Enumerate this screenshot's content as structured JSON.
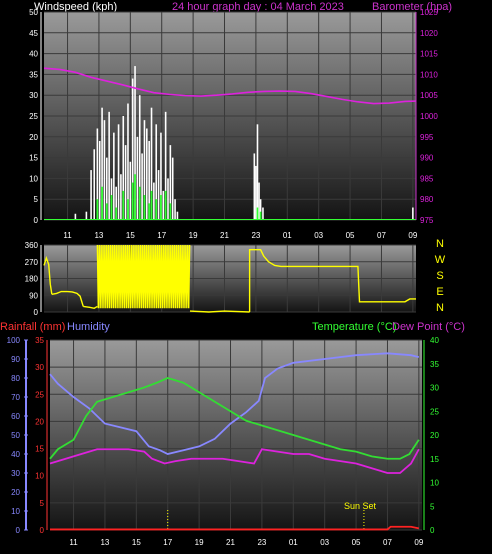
{
  "header": {
    "left": "Windspeed (kph)",
    "center": "24 hour graph day : 04 March 2023",
    "right": "Barometer (hpa)"
  },
  "time_ticks": [
    "11",
    "13",
    "15",
    "17",
    "19",
    "21",
    "23",
    "01",
    "03",
    "05",
    "07",
    "09"
  ],
  "colors": {
    "background": "#000000",
    "wind": "#ffffff",
    "gust": "#ffffff",
    "windavg": "#33ff33",
    "barometer": "#dd22dd",
    "direction": "#ffff00",
    "humidity": "#8888ff",
    "temperature": "#33dd33",
    "dewpoint": "#dd22dd",
    "rain": "#ff2222",
    "title_magenta": "#cc33cc",
    "axis_left_wind": "#ffffff",
    "axis_rain": "#ff3333",
    "axis_humidity": "#8888ff",
    "axis_temp": "#33ff33",
    "sunset": "#ffff00"
  },
  "panel3_labels": {
    "rain": "Rainfall (mm)",
    "humidity": "Humidity",
    "temperature": "Temperature (°C)",
    "dewpoint": "Dew Point (°C)",
    "sunset": "Sun Set"
  },
  "chart_data": [
    {
      "type": "bar",
      "title": "24 hour graph day : 04 March 2023",
      "ylabel": "Windspeed (kph)",
      "ylim": [
        0,
        50
      ],
      "yticks": [
        0,
        5,
        10,
        15,
        20,
        25,
        30,
        35,
        40,
        45,
        50
      ],
      "y2label": "Barometer (hpa)",
      "y2lim": [
        975,
        1025
      ],
      "y2ticks": [
        975,
        980,
        985,
        990,
        995,
        1000,
        1005,
        1010,
        1015,
        1020,
        1025
      ],
      "xlim": [
        9.5,
        33.2
      ],
      "x_ticks_hours": [
        11,
        13,
        15,
        17,
        19,
        21,
        23,
        25,
        27,
        29,
        31,
        33
      ],
      "gust_bars": [
        {
          "x": 11.5,
          "v": 1.5
        },
        {
          "x": 12.2,
          "v": 2
        },
        {
          "x": 12.5,
          "v": 12
        },
        {
          "x": 12.7,
          "v": 17
        },
        {
          "x": 12.9,
          "v": 22
        },
        {
          "x": 13.05,
          "v": 19
        },
        {
          "x": 13.2,
          "v": 27
        },
        {
          "x": 13.35,
          "v": 24
        },
        {
          "x": 13.5,
          "v": 15
        },
        {
          "x": 13.65,
          "v": 26
        },
        {
          "x": 13.8,
          "v": 10
        },
        {
          "x": 13.95,
          "v": 21
        },
        {
          "x": 14.1,
          "v": 8
        },
        {
          "x": 14.25,
          "v": 23
        },
        {
          "x": 14.4,
          "v": 11
        },
        {
          "x": 14.55,
          "v": 25
        },
        {
          "x": 14.7,
          "v": 18
        },
        {
          "x": 14.85,
          "v": 28
        },
        {
          "x": 15.0,
          "v": 14
        },
        {
          "x": 15.15,
          "v": 34
        },
        {
          "x": 15.3,
          "v": 37
        },
        {
          "x": 15.45,
          "v": 20
        },
        {
          "x": 15.6,
          "v": 30
        },
        {
          "x": 15.75,
          "v": 16
        },
        {
          "x": 15.9,
          "v": 24
        },
        {
          "x": 16.05,
          "v": 22
        },
        {
          "x": 16.2,
          "v": 19
        },
        {
          "x": 16.35,
          "v": 27
        },
        {
          "x": 16.5,
          "v": 9
        },
        {
          "x": 16.65,
          "v": 23
        },
        {
          "x": 16.8,
          "v": 12
        },
        {
          "x": 16.95,
          "v": 21
        },
        {
          "x": 17.1,
          "v": 7
        },
        {
          "x": 17.25,
          "v": 26
        },
        {
          "x": 17.4,
          "v": 10
        },
        {
          "x": 17.55,
          "v": 18
        },
        {
          "x": 17.7,
          "v": 15
        },
        {
          "x": 17.85,
          "v": 5
        },
        {
          "x": 18.0,
          "v": 2
        },
        {
          "x": 22.9,
          "v": 16
        },
        {
          "x": 23.0,
          "v": 13
        },
        {
          "x": 23.1,
          "v": 23
        },
        {
          "x": 23.2,
          "v": 9
        },
        {
          "x": 23.3,
          "v": 5
        },
        {
          "x": 23.45,
          "v": 3
        },
        {
          "x": 33.0,
          "v": 3
        }
      ],
      "avg_bars": [
        {
          "x": 12.9,
          "v": 5
        },
        {
          "x": 13.2,
          "v": 8
        },
        {
          "x": 13.5,
          "v": 4
        },
        {
          "x": 13.8,
          "v": 6
        },
        {
          "x": 14.1,
          "v": 3
        },
        {
          "x": 14.55,
          "v": 7
        },
        {
          "x": 14.85,
          "v": 5
        },
        {
          "x": 15.15,
          "v": 9
        },
        {
          "x": 15.3,
          "v": 11
        },
        {
          "x": 15.6,
          "v": 8
        },
        {
          "x": 15.9,
          "v": 6
        },
        {
          "x": 16.2,
          "v": 4
        },
        {
          "x": 16.35,
          "v": 7
        },
        {
          "x": 16.65,
          "v": 5
        },
        {
          "x": 16.95,
          "v": 6
        },
        {
          "x": 17.25,
          "v": 7
        },
        {
          "x": 17.55,
          "v": 4
        },
        {
          "x": 23.1,
          "v": 3
        },
        {
          "x": 23.3,
          "v": 2
        }
      ],
      "barometer": [
        [
          9.5,
          1011.5
        ],
        [
          10.5,
          1011.2
        ],
        [
          11.5,
          1010.5
        ],
        [
          12.5,
          1009.3
        ],
        [
          13.5,
          1008.4
        ],
        [
          14.5,
          1007.5
        ],
        [
          15.5,
          1006.5
        ],
        [
          16.5,
          1005.6
        ],
        [
          17.5,
          1005.2
        ],
        [
          18.5,
          1004.9
        ],
        [
          19.5,
          1004.8
        ],
        [
          20.5,
          1005.0
        ],
        [
          21.5,
          1005.3
        ],
        [
          22.5,
          1005.7
        ],
        [
          23.5,
          1005.9
        ],
        [
          24.5,
          1006.0
        ],
        [
          25.5,
          1005.9
        ],
        [
          26.5,
          1005.4
        ],
        [
          27.5,
          1004.7
        ],
        [
          28.5,
          1004.0
        ],
        [
          29.5,
          1003.4
        ],
        [
          30.5,
          1003.0
        ],
        [
          31.5,
          1003.1
        ],
        [
          32.5,
          1003.5
        ],
        [
          33.2,
          1003.6
        ]
      ]
    },
    {
      "type": "line",
      "ylim": [
        0,
        360
      ],
      "yticks": [
        0,
        90,
        180,
        270,
        360
      ],
      "compass": [
        "N",
        "W",
        "S",
        "E",
        "N"
      ],
      "xlim": [
        9.5,
        33.2
      ],
      "segments": [
        [
          [
            9.5,
            250
          ],
          [
            9.65,
            290
          ],
          [
            9.8,
            255
          ],
          [
            9.9,
            150
          ],
          [
            10.0,
            95
          ]
        ],
        [
          [
            10.0,
            95
          ],
          [
            10.3,
            100
          ],
          [
            10.6,
            110
          ],
          [
            11.0,
            110
          ],
          [
            11.3,
            108
          ],
          [
            11.6,
            100
          ],
          [
            11.8,
            85
          ],
          [
            12.0,
            30
          ]
        ],
        [
          [
            12.0,
            30
          ],
          [
            12.4,
            25
          ],
          [
            12.7,
            20
          ],
          [
            12.9,
            30
          ]
        ],
        [
          [
            22.6,
            0
          ],
          [
            22.6,
            335
          ],
          [
            23.3,
            335
          ],
          [
            23.5,
            300
          ],
          [
            23.8,
            270
          ],
          [
            24.2,
            250
          ],
          [
            24.6,
            245
          ],
          [
            25.5,
            245
          ],
          [
            26.5,
            245
          ],
          [
            27.5,
            245
          ],
          [
            28.5,
            245
          ],
          [
            29.5,
            245
          ],
          [
            29.6,
            55
          ],
          [
            31.5,
            55
          ],
          [
            32.5,
            55
          ],
          [
            32.8,
            70
          ],
          [
            33.2,
            70
          ]
        ]
      ],
      "oscillate": {
        "x0": 12.9,
        "x1": 18.8,
        "low": 20,
        "high": 360
      },
      "tail": [
        [
          18.8,
          5
        ],
        [
          20.0,
          0
        ],
        [
          21.0,
          5
        ],
        [
          22.6,
          0
        ]
      ]
    },
    {
      "type": "line",
      "xlim": [
        9.5,
        33.2
      ],
      "y_rain_lim": [
        0,
        35
      ],
      "y_rain_ticks": [
        0,
        5,
        10,
        15,
        20,
        25,
        30,
        35
      ],
      "y_hum_lim": [
        0,
        100
      ],
      "y_hum_ticks": [
        0,
        10,
        20,
        30,
        40,
        50,
        60,
        70,
        80,
        90,
        100
      ],
      "y_temp_lim": [
        0,
        40
      ],
      "y_temp_ticks": [
        0,
        5,
        10,
        15,
        20,
        25,
        30,
        35,
        40
      ],
      "sunset_hour": 29.5,
      "marker_hour": 17.0,
      "series": [
        {
          "name": "Humidity",
          "axis": "hum",
          "points": [
            [
              9.5,
              82
            ],
            [
              10.0,
              77
            ],
            [
              11.0,
              70
            ],
            [
              12.0,
              64
            ],
            [
              13.0,
              56
            ],
            [
              14.0,
              54
            ],
            [
              15.0,
              52
            ],
            [
              15.8,
              44
            ],
            [
              16.5,
              42
            ],
            [
              17.0,
              40
            ],
            [
              18.0,
              42
            ],
            [
              19.0,
              44
            ],
            [
              20.0,
              48
            ],
            [
              21.0,
              56
            ],
            [
              22.0,
              62
            ],
            [
              22.8,
              68
            ],
            [
              23.2,
              80
            ],
            [
              24.0,
              85
            ],
            [
              25.0,
              88
            ],
            [
              27.0,
              90
            ],
            [
              29.0,
              92
            ],
            [
              31.0,
              93
            ],
            [
              32.5,
              92
            ],
            [
              33.0,
              91
            ]
          ]
        },
        {
          "name": "Temperature (°C)",
          "axis": "temp",
          "points": [
            [
              9.5,
              15
            ],
            [
              10.0,
              17
            ],
            [
              11.0,
              19
            ],
            [
              11.8,
              24
            ],
            [
              12.5,
              27
            ],
            [
              13.5,
              28
            ],
            [
              14.5,
              29
            ],
            [
              15.5,
              30
            ],
            [
              16.3,
              31
            ],
            [
              17.0,
              32
            ],
            [
              18.0,
              31
            ],
            [
              19.0,
              29
            ],
            [
              20.0,
              27
            ],
            [
              21.0,
              25
            ],
            [
              22.0,
              23
            ],
            [
              23.0,
              22
            ],
            [
              24.0,
              21
            ],
            [
              25.0,
              20
            ],
            [
              26.0,
              19
            ],
            [
              27.0,
              18
            ],
            [
              28.0,
              17
            ],
            [
              29.0,
              16.5
            ],
            [
              30.0,
              15.5
            ],
            [
              31.0,
              15
            ],
            [
              31.8,
              15
            ],
            [
              32.4,
              16
            ],
            [
              33.0,
              19
            ]
          ]
        },
        {
          "name": "Dew Point (°C)",
          "axis": "temp",
          "points": [
            [
              9.5,
              14
            ],
            [
              10.5,
              15
            ],
            [
              11.5,
              16
            ],
            [
              12.5,
              17
            ],
            [
              13.5,
              17
            ],
            [
              14.5,
              17
            ],
            [
              15.5,
              16.5
            ],
            [
              16.0,
              15
            ],
            [
              16.8,
              14
            ],
            [
              17.5,
              14.5
            ],
            [
              18.5,
              15
            ],
            [
              19.5,
              15
            ],
            [
              20.5,
              15
            ],
            [
              21.5,
              14.5
            ],
            [
              22.5,
              14
            ],
            [
              23.0,
              17
            ],
            [
              24.0,
              16.5
            ],
            [
              25.0,
              16
            ],
            [
              26.0,
              16
            ],
            [
              27.0,
              15
            ],
            [
              28.0,
              14.5
            ],
            [
              29.0,
              14
            ],
            [
              30.0,
              13
            ],
            [
              31.0,
              12
            ],
            [
              31.8,
              12
            ],
            [
              32.5,
              14
            ],
            [
              33.0,
              17
            ]
          ]
        },
        {
          "name": "Rainfall (mm)",
          "axis": "rain",
          "points": [
            [
              9.5,
              0.1
            ],
            [
              30.0,
              0.1
            ],
            [
              31.0,
              0.1
            ],
            [
              31.2,
              0.6
            ],
            [
              32.5,
              0.6
            ],
            [
              33.0,
              0.3
            ]
          ]
        }
      ]
    }
  ]
}
